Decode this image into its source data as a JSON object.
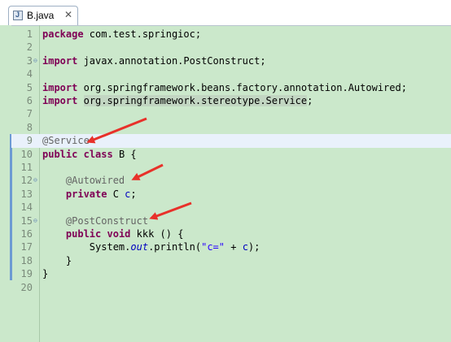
{
  "tab": {
    "filename": "B.java",
    "close_glyph": "✕"
  },
  "colors": {
    "background": "#cbe8cb",
    "keyword": "#7f0055",
    "annotation": "#646464",
    "field": "#0000c0",
    "string": "#2a00ff",
    "current_line": "#e9f1fb",
    "arrow": "#e8312a"
  },
  "lines": [
    {
      "n": "1",
      "parts": [
        {
          "t": "package",
          "c": "kw"
        },
        {
          "t": " com.test.springioc;"
        }
      ]
    },
    {
      "n": "2",
      "parts": []
    },
    {
      "n": "3",
      "fold": true,
      "parts": [
        {
          "t": "import",
          "c": "kw"
        },
        {
          "t": " javax.annotation.PostConstruct;"
        }
      ]
    },
    {
      "n": "4",
      "parts": []
    },
    {
      "n": "5",
      "parts": [
        {
          "t": "import",
          "c": "kw"
        },
        {
          "t": " org.springframework.beans.factory.annotation.Autowired;"
        }
      ]
    },
    {
      "n": "6",
      "parts": [
        {
          "t": "import",
          "c": "kw"
        },
        {
          "t": " "
        },
        {
          "t": "org.springframework.stereotype.Service",
          "c": "import-hl"
        },
        {
          "t": ";"
        }
      ]
    },
    {
      "n": "7",
      "parts": []
    },
    {
      "n": "8",
      "parts": []
    },
    {
      "n": "9",
      "highlight": true,
      "parts": [
        {
          "t": "@Service",
          "c": "ann"
        }
      ]
    },
    {
      "n": "10",
      "parts": [
        {
          "t": "public",
          "c": "kw"
        },
        {
          "t": " "
        },
        {
          "t": "class",
          "c": "kw"
        },
        {
          "t": " B {"
        }
      ]
    },
    {
      "n": "11",
      "parts": []
    },
    {
      "n": "12",
      "fold": true,
      "parts": [
        {
          "t": "    "
        },
        {
          "t": "@Autowired",
          "c": "ann"
        }
      ]
    },
    {
      "n": "13",
      "parts": [
        {
          "t": "    "
        },
        {
          "t": "private",
          "c": "kw"
        },
        {
          "t": " C "
        },
        {
          "t": "c",
          "c": "fld"
        },
        {
          "t": ";"
        }
      ]
    },
    {
      "n": "14",
      "parts": []
    },
    {
      "n": "15",
      "fold": true,
      "parts": [
        {
          "t": "    "
        },
        {
          "t": "@PostConstruct",
          "c": "ann"
        }
      ]
    },
    {
      "n": "16",
      "parts": [
        {
          "t": "    "
        },
        {
          "t": "public",
          "c": "kw"
        },
        {
          "t": " "
        },
        {
          "t": "void",
          "c": "kw"
        },
        {
          "t": " kkk () {"
        }
      ]
    },
    {
      "n": "17",
      "parts": [
        {
          "t": "        System."
        },
        {
          "t": "out",
          "c": "st"
        },
        {
          "t": ".println("
        },
        {
          "t": "\"c=\"",
          "c": "str"
        },
        {
          "t": " + "
        },
        {
          "t": "c",
          "c": "fld"
        },
        {
          "t": ");"
        }
      ]
    },
    {
      "n": "18",
      "parts": [
        {
          "t": "    }"
        }
      ]
    },
    {
      "n": "19",
      "parts": [
        {
          "t": "}"
        }
      ]
    },
    {
      "n": "20",
      "parts": []
    }
  ],
  "arrows": [
    {
      "name": "arrow-service",
      "target_line": "9"
    },
    {
      "name": "arrow-autowired",
      "target_line": "12"
    },
    {
      "name": "arrow-postconstruct",
      "target_line": "15"
    }
  ]
}
